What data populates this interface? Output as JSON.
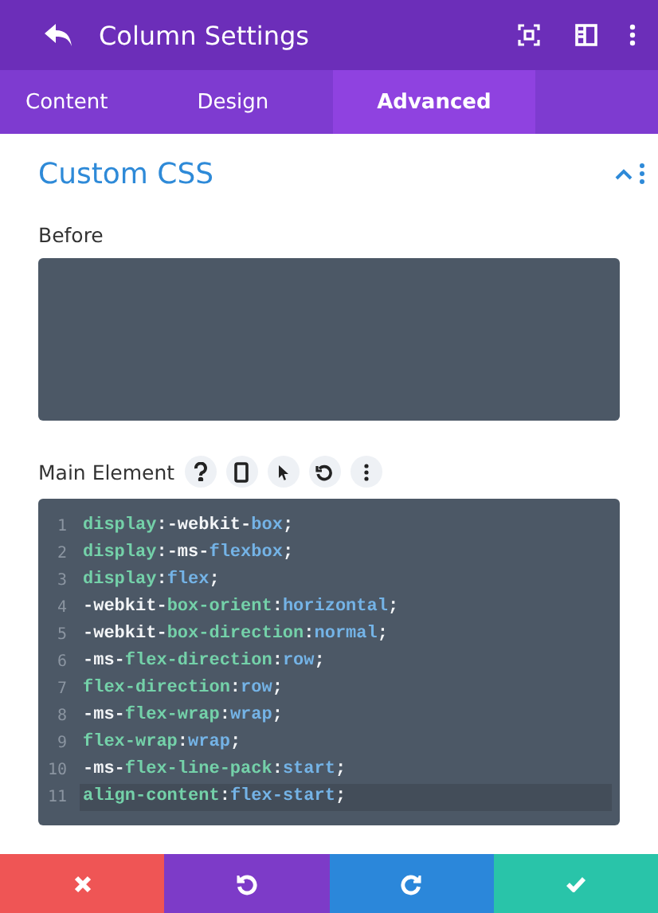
{
  "header": {
    "title": "Column Settings"
  },
  "tabs": [
    {
      "label": "Content",
      "selected": false
    },
    {
      "label": "Design",
      "selected": false
    },
    {
      "label": "Advanced",
      "selected": true
    }
  ],
  "section": {
    "title": "Custom CSS",
    "expanded": true
  },
  "fields": [
    {
      "label": "Before",
      "kind": "empty"
    },
    {
      "label": "Main Element",
      "kind": "code",
      "lines": [
        {
          "number": "1",
          "active": false,
          "tokens": [
            {
              "text": "display",
              "kind": "prop"
            },
            {
              "text": ":-webkit-",
              "kind": "plain"
            },
            {
              "text": "box",
              "kind": "value"
            },
            {
              "text": ";",
              "kind": "plain"
            }
          ]
        },
        {
          "number": "2",
          "active": false,
          "tokens": [
            {
              "text": "display",
              "kind": "prop"
            },
            {
              "text": ":-ms-",
              "kind": "plain"
            },
            {
              "text": "flexbox",
              "kind": "value"
            },
            {
              "text": ";",
              "kind": "plain"
            }
          ]
        },
        {
          "number": "3",
          "active": false,
          "tokens": [
            {
              "text": "display",
              "kind": "prop"
            },
            {
              "text": ":",
              "kind": "plain"
            },
            {
              "text": "flex",
              "kind": "value"
            },
            {
              "text": ";",
              "kind": "plain"
            }
          ]
        },
        {
          "number": "4",
          "active": false,
          "tokens": [
            {
              "text": "-webkit-",
              "kind": "plain"
            },
            {
              "text": "box-orient",
              "kind": "prop"
            },
            {
              "text": ":",
              "kind": "plain"
            },
            {
              "text": "horizontal",
              "kind": "value"
            },
            {
              "text": ";",
              "kind": "plain"
            }
          ]
        },
        {
          "number": "5",
          "active": false,
          "tokens": [
            {
              "text": "-webkit-",
              "kind": "plain"
            },
            {
              "text": "box-direction",
              "kind": "prop"
            },
            {
              "text": ":",
              "kind": "plain"
            },
            {
              "text": "normal",
              "kind": "value"
            },
            {
              "text": ";",
              "kind": "plain"
            }
          ]
        },
        {
          "number": "6",
          "active": false,
          "tokens": [
            {
              "text": "-ms-",
              "kind": "plain"
            },
            {
              "text": "flex-direction",
              "kind": "prop"
            },
            {
              "text": ":",
              "kind": "plain"
            },
            {
              "text": "row",
              "kind": "value"
            },
            {
              "text": ";",
              "kind": "plain"
            }
          ]
        },
        {
          "number": "7",
          "active": false,
          "tokens": [
            {
              "text": "flex-direction",
              "kind": "prop"
            },
            {
              "text": ":",
              "kind": "plain"
            },
            {
              "text": "row",
              "kind": "value"
            },
            {
              "text": ";",
              "kind": "plain"
            }
          ]
        },
        {
          "number": "8",
          "active": false,
          "tokens": [
            {
              "text": "-ms-",
              "kind": "plain"
            },
            {
              "text": "flex-wrap",
              "kind": "prop"
            },
            {
              "text": ":",
              "kind": "plain"
            },
            {
              "text": "wrap",
              "kind": "value"
            },
            {
              "text": ";",
              "kind": "plain"
            }
          ]
        },
        {
          "number": "9",
          "active": false,
          "tokens": [
            {
              "text": "flex-wrap",
              "kind": "prop"
            },
            {
              "text": ":",
              "kind": "plain"
            },
            {
              "text": "wrap",
              "kind": "value"
            },
            {
              "text": ";",
              "kind": "plain"
            }
          ]
        },
        {
          "number": "10",
          "active": false,
          "tokens": [
            {
              "text": "-ms-",
              "kind": "plain"
            },
            {
              "text": "flex-line-pack",
              "kind": "prop"
            },
            {
              "text": ":",
              "kind": "plain"
            },
            {
              "text": "start",
              "kind": "value"
            },
            {
              "text": ";",
              "kind": "plain"
            }
          ]
        },
        {
          "number": "11",
          "active": true,
          "tokens": [
            {
              "text": "align-content",
              "kind": "prop"
            },
            {
              "text": ":",
              "kind": "plain"
            },
            {
              "text": "flex-start",
              "kind": "value"
            },
            {
              "text": ";",
              "kind": "plain"
            }
          ]
        }
      ]
    }
  ]
}
